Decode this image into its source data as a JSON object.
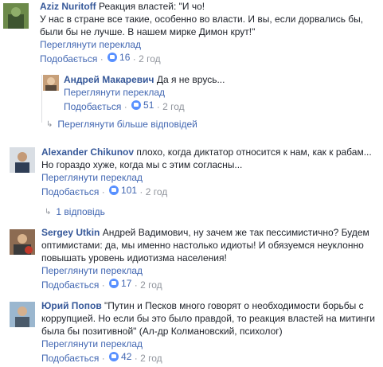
{
  "comments": [
    {
      "name": "Aziz Nuritoff",
      "lines": [
        "Реакция властей: \"И чо!",
        "У нас в стране все такие, особенно во власти. И вы, если дорвались бы,",
        "были бы не лучше. В нашем мирке Димон крут!\""
      ],
      "translate": "Переглянути переклад",
      "like": "Подобається",
      "likes": "16",
      "time": "2 год"
    },
    {
      "name": "Андрей Макаревич",
      "lines": [
        "Да я не врусь..."
      ],
      "translate": "Переглянути переклад",
      "like": "Подобається",
      "likes": "51",
      "time": "2 год"
    },
    {
      "name": "Alexander Chikunov",
      "lines": [
        "плохо, когда диктатор относится к нам, как к рабам...",
        "Но гораздо хуже, когда мы с этим согласны..."
      ],
      "translate": "Переглянути переклад",
      "like": "Подобається",
      "likes": "101",
      "time": "2 год"
    },
    {
      "name": "Sergey Utkin",
      "lines": [
        "Андрей Вадимович, ну зачем же так пессимистично? Будем",
        "оптимистами: да, мы именно настолько идиоты! И обязуемся неуклонно",
        "повышать уровень идиотизма населения!"
      ],
      "translate": "Переглянути переклад",
      "like": "Подобається",
      "likes": "17",
      "time": "2 год"
    },
    {
      "name": "Юрий Попов",
      "lines": [
        "\"Путин и Песков много говорят о необходимости борьбы с",
        "коррупцией. Но если бы это было правдой, то реакция властей на митинги",
        "была бы позитивной\" (Ал-др Колмановский, психолог)"
      ],
      "translate": "Переглянути переклад",
      "like": "Подобається",
      "likes": "42",
      "time": "2 год"
    }
  ],
  "more_replies": "Переглянути більше відповідей",
  "one_reply": "1 відповідь",
  "sep": "·",
  "colors": {
    "link": "#4267b2",
    "name": "#365899",
    "meta": "#90949c"
  },
  "icons": {
    "like": "like-icon",
    "reply": "reply-arrow-icon"
  }
}
